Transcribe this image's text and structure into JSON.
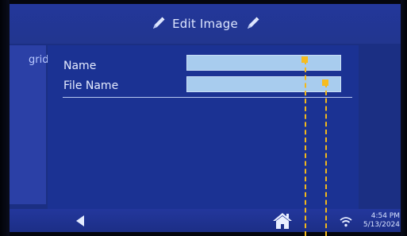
{
  "title_bar": {
    "title": "Edit Image",
    "left_icon": "pencil-icon",
    "right_icon": "pencil-icon"
  },
  "side_panel": {
    "label": "grid"
  },
  "form": {
    "rows": [
      {
        "label": "Name",
        "value": ""
      },
      {
        "label": "File Name",
        "value": ""
      }
    ]
  },
  "bottom_bar": {
    "back_icon": "back-arrow-icon",
    "home_icon": "home-icon",
    "wifi_icon": "wifi-icon",
    "time": "4:54 PM",
    "date": "5/13/2024"
  },
  "colors": {
    "background": "#1b3293",
    "bar": "#23379a",
    "field": "#a8ccee",
    "marker": "#f6bc1f"
  }
}
